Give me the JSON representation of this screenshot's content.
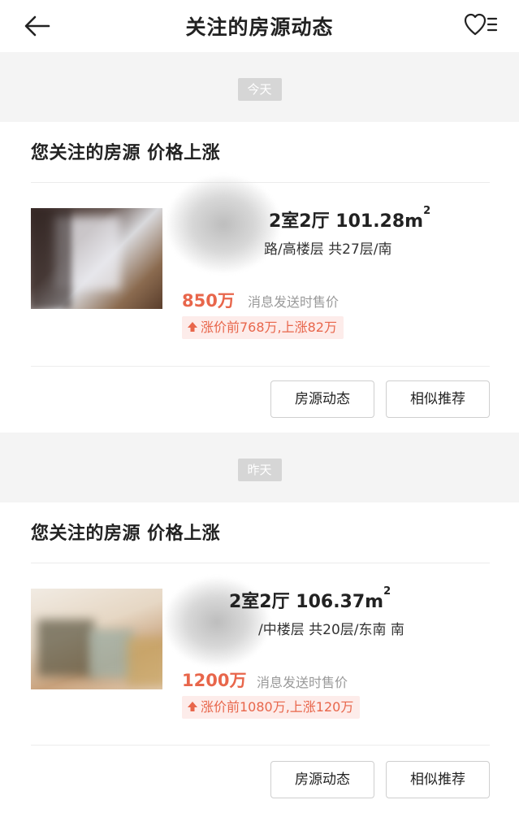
{
  "header": {
    "title": "关注的房源动态"
  },
  "groups": [
    {
      "date_label": "今天",
      "card": {
        "heading": "您关注的房源 价格上涨",
        "house_title": "2室2厅 101.28m",
        "house_title_sup": "2",
        "house_meta": "路/高楼层 共27层/南",
        "price": "850万",
        "price_note": "消息发送时售价",
        "rise_text": "涨价前768万,上涨82万",
        "buttons": {
          "dynamics": "房源动态",
          "similar": "相似推荐"
        }
      }
    },
    {
      "date_label": "昨天",
      "card": {
        "heading": "您关注的房源 价格上涨",
        "house_title": "2室2厅 106.37m",
        "house_title_sup": "2",
        "house_meta": "/中楼层 共20层/东南 南",
        "price": "1200万",
        "price_note": "消息发送时售价",
        "rise_text": "涨价前1080万,上涨120万",
        "buttons": {
          "dynamics": "房源动态",
          "similar": "相似推荐"
        }
      }
    }
  ],
  "icons": {
    "back": "arrow-left-icon",
    "favorites": "heart-list-icon",
    "rise": "arrow-up-icon"
  },
  "colors": {
    "accent": "#e8664b",
    "accent_bg": "#fdecea",
    "date_pill": "#d6d6d6",
    "page_bg": "#f4f4f4"
  }
}
